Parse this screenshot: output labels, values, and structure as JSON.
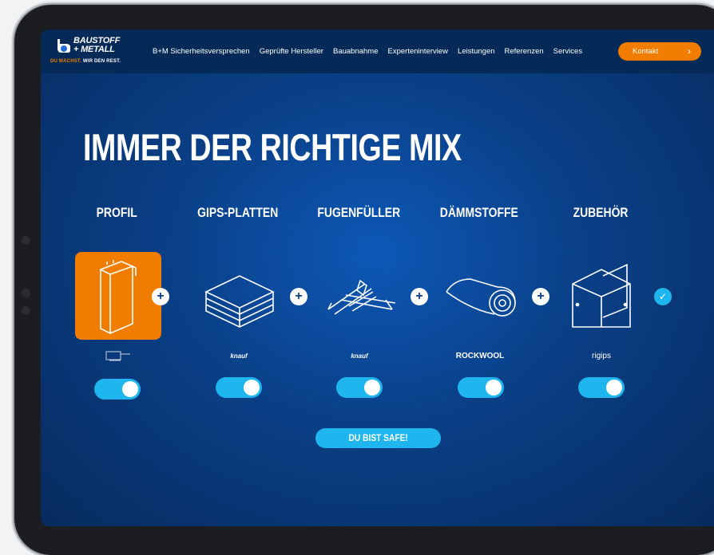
{
  "logo": {
    "name_line1": "BAUSTOFF",
    "name_line2": "+ METALL",
    "tagline_a": "DU MACHST.",
    "tagline_b": " WIR DEN REST."
  },
  "nav": {
    "items": [
      "B+M Sicherheitsversprechen",
      "Geprüfte Hersteller",
      "Bauabnahme",
      "Experteninterview",
      "Leistungen",
      "Referenzen",
      "Services"
    ],
    "cta": "Kontakt"
  },
  "headline": "IMMER DER RICHTIGE MIX",
  "categories": [
    {
      "title": "PROFIL",
      "brand": "",
      "selected": true
    },
    {
      "title": "GIPS-PLATTEN",
      "brand": "knauf",
      "selected": false
    },
    {
      "title": "FUGENFÜLLER",
      "brand": "knauf",
      "selected": false
    },
    {
      "title": "DÄMMSTOFFE",
      "brand": "ROCKWOOL",
      "selected": false
    },
    {
      "title": "ZUBEHÖR",
      "brand": "rigips",
      "selected": false
    }
  ],
  "cta_button": "DU BIST SAFE!",
  "colors": {
    "accent": "#f07d00",
    "toggle": "#1fb6ef",
    "nav_bg": "#062a57",
    "bg": "#0a3f86"
  }
}
